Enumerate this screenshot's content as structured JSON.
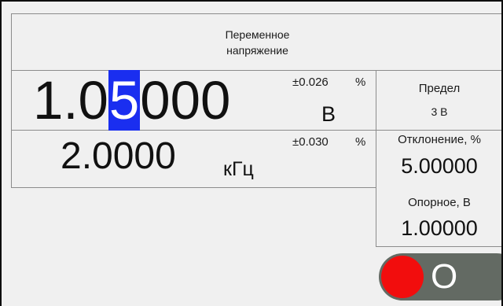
{
  "header": {
    "line1": "Переменное",
    "line2": "напряжение"
  },
  "voltage": {
    "digits_before": "1.0",
    "digit_selected": "5",
    "digits_after": "000",
    "tolerance": "±0.026",
    "tolerance_unit": "%",
    "unit": "В"
  },
  "frequency": {
    "value": "2.0000",
    "unit": "кГц",
    "tolerance": "±0.030",
    "tolerance_unit": "%"
  },
  "limit": {
    "title": "Предел",
    "value": "3 В"
  },
  "deviation": {
    "title": "Отклонение, %",
    "value": "5.00000"
  },
  "reference": {
    "title": "Опорное,  В",
    "value": "1.00000"
  },
  "output_toggle": {
    "label": "O",
    "state": "off",
    "knob_color": "#f20d0d",
    "track_color": "#636a63"
  },
  "colors": {
    "cursor": "#1a2ef0",
    "background": "#f0f0f0",
    "border": "#8c8c8c"
  }
}
